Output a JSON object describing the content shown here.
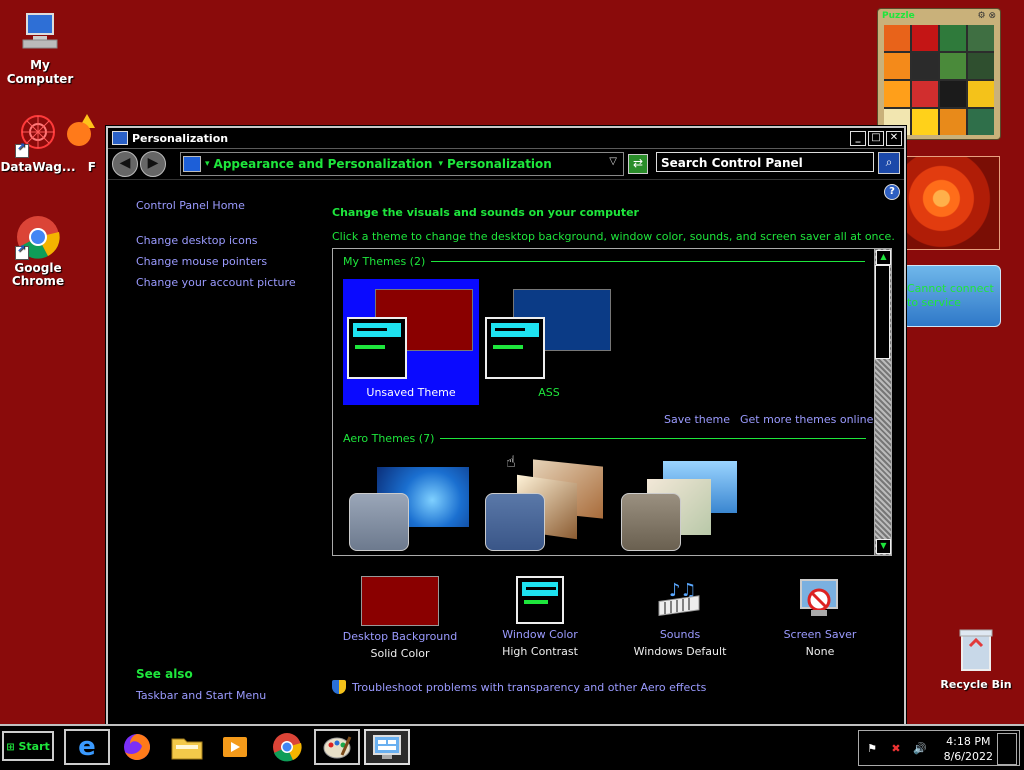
{
  "desktop": {
    "icons": [
      {
        "label": "My Computer"
      },
      {
        "label": "DataWag..."
      },
      {
        "label": "F"
      },
      {
        "label": "Google Chrome"
      },
      {
        "label": "Recycle Bin"
      }
    ],
    "gadgets": {
      "puzzle_title": "Puzzle",
      "weather_text": "Cannot connect to service"
    }
  },
  "window": {
    "title": "Personalization",
    "breadcrumb": [
      "Appearance and Personalization",
      "Personalization"
    ],
    "search_placeholder": "Search Control Panel",
    "left_nav": {
      "items": [
        "Control Panel Home",
        "Change desktop icons",
        "Change mouse pointers",
        "Change your account picture"
      ],
      "see_also_heading": "See also",
      "see_also_items": [
        "Taskbar and Start Menu"
      ]
    },
    "heading": "Change the visuals and sounds on your computer",
    "subheading": "Click a theme to change the desktop background, window color, sounds, and screen saver all at once.",
    "my_themes": {
      "label": "My Themes (2)",
      "themes": [
        {
          "name": "Unsaved Theme",
          "selected": true,
          "bg_color": "#8a0000"
        },
        {
          "name": "ASS",
          "selected": false,
          "bg_color": "#0b3b86"
        }
      ],
      "save_link": "Save theme",
      "more_link": "Get more themes online"
    },
    "aero_themes": {
      "label": "Aero Themes (7)"
    },
    "bottom": [
      {
        "label": "Desktop Background",
        "value": "Solid Color",
        "icon": "desktop-background-icon"
      },
      {
        "label": "Window Color",
        "value": "High Contrast",
        "icon": "window-color-icon"
      },
      {
        "label": "Sounds",
        "value": "Windows Default",
        "icon": "sounds-icon"
      },
      {
        "label": "Screen Saver",
        "value": "None",
        "icon": "screen-saver-icon"
      }
    ],
    "troubleshoot": "Troubleshoot problems with transparency and other Aero effects"
  },
  "taskbar": {
    "start_label": "Start",
    "apps": [
      "Internet Explorer",
      "Firefox",
      "Windows Explorer",
      "Media Player",
      "Chrome",
      "Paint",
      "Control Panel"
    ],
    "clock_time": "4:18 PM",
    "clock_date": "8/6/2022"
  },
  "colors": {
    "desktop_bg": "#8a0b0b",
    "accent_green": "#1ee63c",
    "link_blue": "#9b9bff",
    "highlight": "#0a0aff"
  }
}
